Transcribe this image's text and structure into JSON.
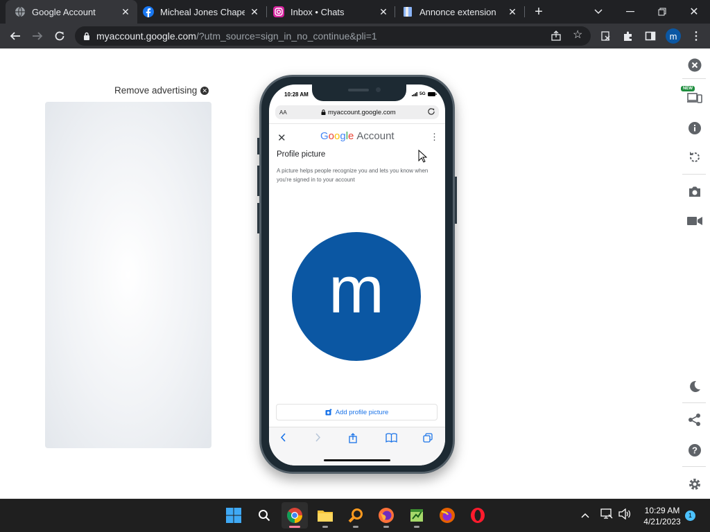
{
  "browser": {
    "tabs": [
      {
        "title": "Google Account",
        "active": true,
        "icon": "globe-icon"
      },
      {
        "title": "Micheal Jones Chapel |",
        "active": false,
        "icon": "facebook-icon"
      },
      {
        "title": "Inbox • Chats",
        "active": false,
        "icon": "instagram-icon"
      },
      {
        "title": "Annonce extension",
        "active": false,
        "icon": "document-icon"
      }
    ],
    "url_host": "myaccount.google.com",
    "url_rest": "/?utm_source=sign_in_no_continue&pli=1",
    "profile_initial": "m"
  },
  "ad": {
    "remove_label": "Remove advertising"
  },
  "phone": {
    "status_time": "10:28 AM",
    "status_network": "5G",
    "safari_aa": "AA",
    "safari_url": "myaccount.google.com",
    "header": {
      "google_letters": [
        "G",
        "o",
        "o",
        "g",
        "l",
        "e"
      ],
      "account_word": "Account"
    },
    "profile": {
      "heading": "Profile picture",
      "description": "A picture helps people recognize you and lets you know when you're signed in to your account",
      "avatar_letter": "m",
      "add_button": "Add profile picture"
    }
  },
  "side_rail": {
    "new_badge": "NEW"
  },
  "taskbar": {
    "time": "10:29 AM",
    "date": "4/21/2023",
    "notification_count": "1"
  },
  "colors": {
    "avatar_blue": "#0b57a3",
    "link_blue": "#1a73e8",
    "chrome_dark": "#202124"
  }
}
